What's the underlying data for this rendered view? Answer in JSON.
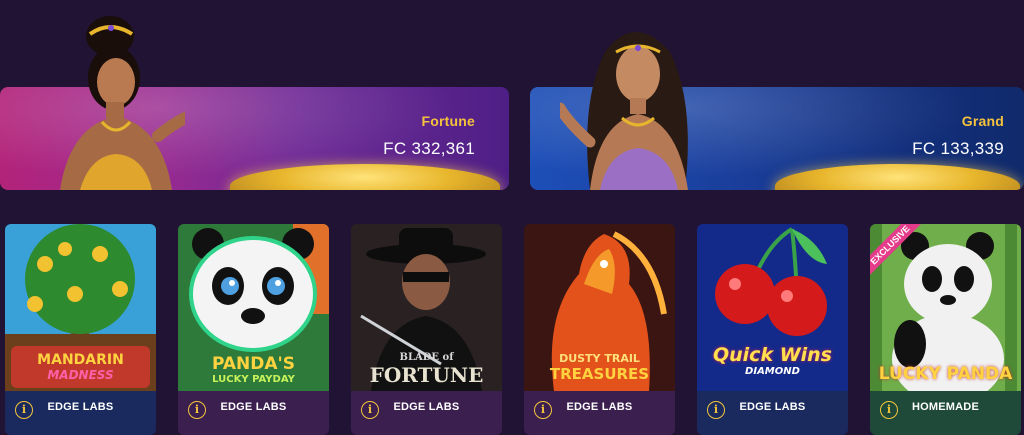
{
  "jackpots": [
    {
      "name": "Fortune",
      "value": "FC 332,361"
    },
    {
      "name": "Grand",
      "value": "FC 133,339"
    }
  ],
  "games": [
    {
      "logo_lines": [
        "MANDARIN",
        "MADNESS"
      ],
      "provider": "EDGE LABS"
    },
    {
      "logo_lines": [
        "PANDA'S",
        "LUCKY PAYDAY"
      ],
      "provider": "EDGE LABS"
    },
    {
      "logo_lines": [
        "BLADE of",
        "FORTUNE"
      ],
      "provider": "EDGE LABS"
    },
    {
      "logo_lines": [
        "DUSTY TRAIL",
        "TREASURES"
      ],
      "provider": "EDGE LABS"
    },
    {
      "logo_lines": [
        "Quick Wins",
        "DIAMOND"
      ],
      "provider": "EDGE LABS"
    },
    {
      "logo_lines": [
        "LUCKY PANDA"
      ],
      "provider": "HOMEMADE",
      "badge": "EXCLUSIVE"
    }
  ],
  "info_glyph": "i",
  "colors": {
    "background": "#211333",
    "accent_gold": "#f3c53b",
    "card_footer_blue": "#1a2a5e",
    "card_footer_purple": "#3b1f4f",
    "card_footer_green": "#1f4a3a",
    "exclusive_badge": "#e43c8a"
  }
}
